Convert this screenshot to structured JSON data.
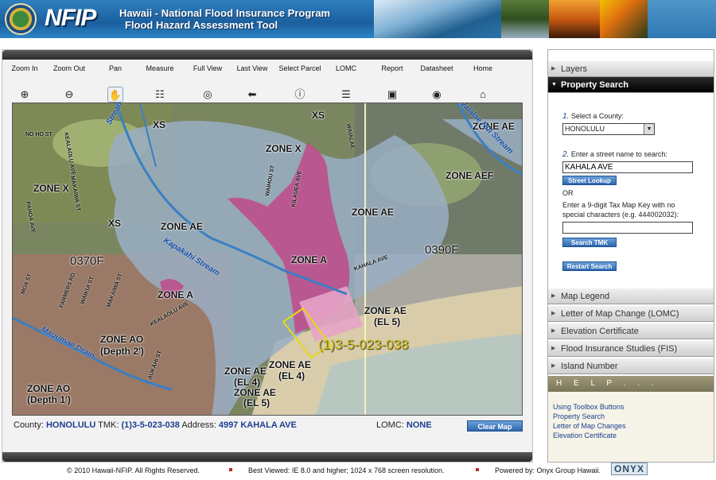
{
  "header": {
    "logo": "NFIP",
    "title_line1": "Hawaii - National Flood Insurance Program",
    "title_line2": "Flood Hazard Assessment Tool"
  },
  "toolbar": [
    {
      "label": "Zoom In",
      "icon": "zoom-in-icon",
      "glyph": "⊕"
    },
    {
      "label": "Zoom Out",
      "icon": "zoom-out-icon",
      "glyph": "⊖"
    },
    {
      "label": "Pan",
      "icon": "hand-icon",
      "glyph": "✋"
    },
    {
      "label": "Measure",
      "icon": "ruler-icon",
      "glyph": "☷"
    },
    {
      "label": "Full View",
      "icon": "globe-icon",
      "glyph": "◎"
    },
    {
      "label": "Last View",
      "icon": "back-arrow-icon",
      "glyph": "⬅"
    },
    {
      "label": "Select Parcel",
      "icon": "info-icon",
      "glyph": "ⓘ"
    },
    {
      "label": "LOMC",
      "icon": "list-icon",
      "glyph": "☰"
    },
    {
      "label": "Report",
      "icon": "report-icon",
      "glyph": "▣"
    },
    {
      "label": "Datasheet",
      "icon": "datasheet-icon",
      "glyph": "◉"
    },
    {
      "label": "Home",
      "icon": "home-icon",
      "glyph": "⌂"
    }
  ],
  "map": {
    "zones": {
      "z1": "XS",
      "z2": "XS",
      "z3": "ZONE X",
      "z4": "ZONE AE",
      "z5": "ZONE AEF",
      "z6": "ZONE X",
      "z7": "XS",
      "z8": "ZONE AE",
      "z9": "ZONE AE",
      "z10": "ZONE A",
      "z11": "ZONE A",
      "z12": "ZONE AE",
      "z12b": "(EL 5)",
      "z13": "ZONE AO",
      "z13b": "(Depth 2')",
      "z14": "ZONE AE",
      "z14b": "(EL 4)",
      "z15": "ZONE AE",
      "z15b": "(EL 4)",
      "z16": "ZONE AE",
      "z16b": "(EL 5)",
      "z17": "ZONE AO",
      "z17b": "(Depth 1')"
    },
    "panels": {
      "p1": "0370F",
      "p2": "0390F"
    },
    "streams": {
      "s1": "Stream",
      "s2": "Kapakahi Stream",
      "s3": "Waialae Nui Stream",
      "s4": "Mauumae Drain"
    },
    "streets": {
      "st1": "NO HO ST",
      "st2": "KEALAOLU AVE",
      "st3": "MAKAIWA ST",
      "st4": "PAHOA AVE",
      "st5": "WAIALAE",
      "st6": "KAHALA AVE",
      "st7": "KEALAOLU AVE",
      "st8": "MOA ST",
      "st9": "FARMERS RD",
      "st10": "WAIKUI ST",
      "st11": "MAKAIWA ST",
      "st12": "WAIHOU ST",
      "st13": "KILAUEA AVE",
      "st14": "AUKAHI ST"
    },
    "tmk_label": "(1)3-5-023-038"
  },
  "status": {
    "county_label": "County:",
    "county": "HONOLULU",
    "tmk_label": "TMK:",
    "tmk": "(1)3-5-023-038",
    "address_label": "Address:",
    "address": "4997 KAHALA AVE",
    "lomc_label": "LOMC:",
    "lomc": "NONE",
    "clear_button": "Clear Map"
  },
  "sidebar": {
    "layers": "Layers",
    "property_search": "Property Search",
    "step1_num": "1.",
    "step1": "Select a County:",
    "county_value": "HONOLULU",
    "step2_num": "2.",
    "step2": "Enter a street name to search:",
    "street_value": "KAHALA AVE",
    "street_lookup": "Street Lookup",
    "or": "OR",
    "tmk_prompt1": "Enter a 9-digit Tax Map Key with no",
    "tmk_prompt2": "special characters (e.g. 444002032):",
    "tmk_value": "",
    "search_tmk": "Search TMK",
    "restart": "Restart Search",
    "sections": [
      "Map Legend",
      "Letter of Map Change (LOMC)",
      "Elevation Certificate",
      "Flood Insurance Studies (FIS)",
      "Island Number"
    ],
    "help": "H E L P . . .",
    "help_links": [
      "Using Toolbox Buttons",
      "Property Search",
      "Letter of Map Changes",
      "Elevation Certificate"
    ]
  },
  "footer": {
    "copyright": "© 2010  Hawaii-NFIP.  All Rights Reserved.",
    "best_viewed": "Best Viewed: IE 8.0 and higher; 1024 x 768 screen resolution.",
    "powered": "Powered by: Onyx Group Hawaii.",
    "onyx_logo": "ONYX"
  }
}
